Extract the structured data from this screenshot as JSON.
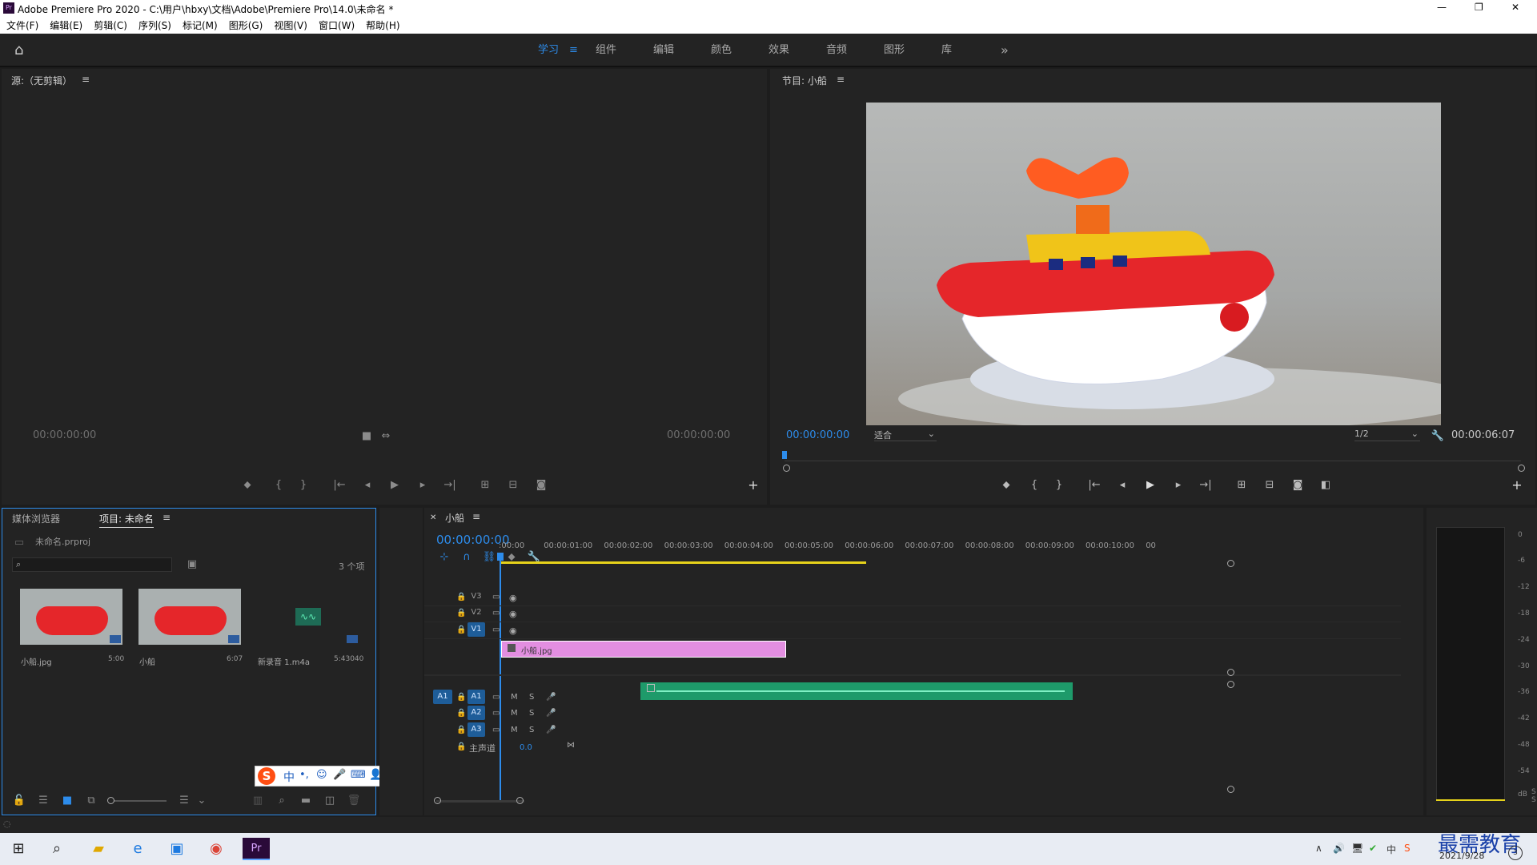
{
  "app": {
    "title": "Adobe Premiere Pro 2020 - C:\\用户\\hbxy\\文档\\Adobe\\Premiere Pro\\14.0\\未命名 *",
    "logo": "Pr"
  },
  "window_controls": {
    "minimize": "—",
    "restore": "❐",
    "close": "✕"
  },
  "menu": [
    "文件(F)",
    "编辑(E)",
    "剪辑(C)",
    "序列(S)",
    "标记(M)",
    "图形(G)",
    "视图(V)",
    "窗口(W)",
    "帮助(H)"
  ],
  "workspaces": {
    "active": "学习",
    "items": [
      "组件",
      "编辑",
      "颜色",
      "效果",
      "音频",
      "图形",
      "库"
    ],
    "more": "»"
  },
  "source": {
    "title": "源:（无剪辑）",
    "tc_left": "00:00:00:00",
    "tc_right": "00:00:00:00"
  },
  "program": {
    "title": "节目: 小船",
    "tc_left": "00:00:00:00",
    "fit": "适合",
    "res": "1/2",
    "tc_right": "00:00:06:07"
  },
  "project": {
    "tab1": "媒体浏览器",
    "tab2": "项目: 未命名",
    "file": "未命名.prproj",
    "count": "3 个项",
    "items": [
      {
        "name": "小船.jpg",
        "dur": "5:00"
      },
      {
        "name": "小船",
        "dur": "6:07"
      },
      {
        "name": "新录音 1.m4a",
        "dur": "5:43040"
      }
    ]
  },
  "timeline": {
    "tab": "小船",
    "tc": "00:00:00:00",
    "ruler": [
      ":00:00",
      "00:00:01:00",
      "00:00:02:00",
      "00:00:03:00",
      "00:00:04:00",
      "00:00:05:00",
      "00:00:06:00",
      "00:00:07:00",
      "00:00:08:00",
      "00:00:09:00",
      "00:00:10:00",
      "00"
    ],
    "video_tracks": [
      "V3",
      "V2",
      "V1"
    ],
    "audio_tracks": [
      "A1",
      "A2",
      "A3"
    ],
    "src_patch": "A1",
    "m": "M",
    "s": "S",
    "master": "主声道",
    "master_val": "0.0",
    "clip_video": "小船.jpg"
  },
  "meter": {
    "labels": [
      "0",
      "-6",
      "-12",
      "-18",
      "-24",
      "-30",
      "-36",
      "-42",
      "-48",
      "-54",
      "dB"
    ],
    "s1": "S",
    "s2": "S"
  },
  "ime": {
    "label": "中"
  },
  "taskbar": {
    "date": "2021/9/28",
    "watermark": "最需教育"
  },
  "colors": {
    "accent": "#2d8ceb",
    "clip_video": "#e38ee1",
    "clip_audio": "#1e9a6a",
    "workarea": "#e6d21b"
  }
}
